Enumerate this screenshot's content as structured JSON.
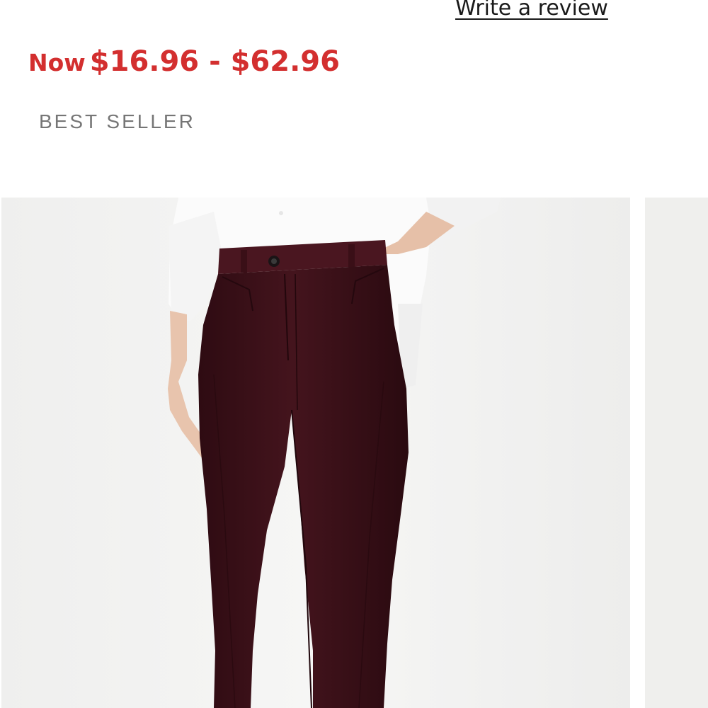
{
  "product": {
    "write_review_label": "Write a review",
    "price_prefix": "Now",
    "price_range": "$16.96 - $62.96",
    "badge": "BEST SELLER"
  },
  "gallery": {
    "images": [
      {
        "subject": "product-photo-burgundy-pants"
      },
      {
        "subject": "product-photo-next"
      }
    ]
  },
  "colors": {
    "sale_price": "#d32f2f",
    "badge_text": "#767676",
    "image_bg": "#f1f1f0",
    "pants": "#3b1119",
    "shirt": "#fbfbfb",
    "skin": "#e8c4ad"
  }
}
